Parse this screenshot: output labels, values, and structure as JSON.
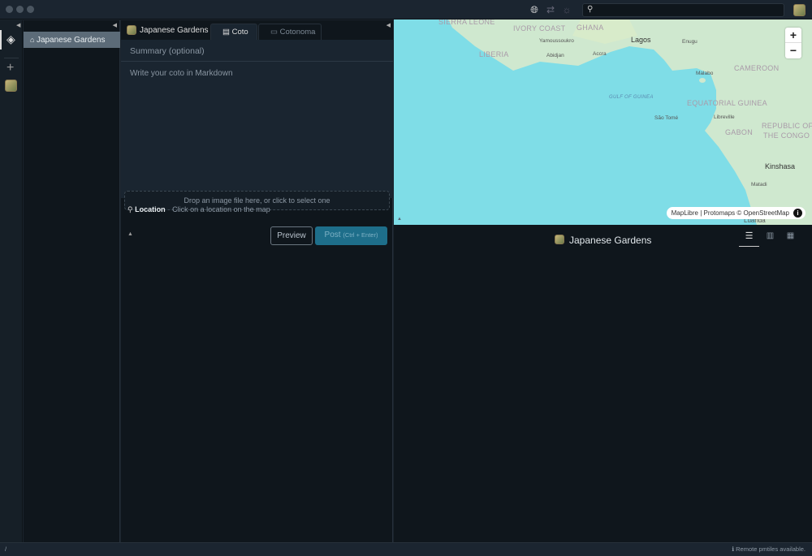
{
  "sidebar": {
    "collapse_icon": "caret-left-icon",
    "rail": [
      {
        "icon": "layers-icon"
      },
      {
        "icon": "plus-icon"
      },
      {
        "icon": "cotonoma-avatar"
      }
    ],
    "items": [
      {
        "label": "Japanese Gardens",
        "icon": "home-icon"
      }
    ]
  },
  "toolbar": {
    "icons": [
      "globe-icon",
      "swap-icon",
      "sun-icon"
    ],
    "search_placeholder": ""
  },
  "editor": {
    "cotonoma": "Japanese Gardens",
    "tabs": [
      {
        "label": "Coto",
        "icon": "document-icon",
        "active": true
      },
      {
        "label": "Cotonoma",
        "icon": "folder-icon",
        "active": false
      }
    ],
    "summary_placeholder": "Summary (optional)",
    "body_placeholder": "Write your coto in Markdown",
    "drop_text": "Drop an image file here, or click to select one",
    "location_label": "Location",
    "location_hint": "Click on a location on the map",
    "preview_label": "Preview",
    "post_label": "Post",
    "post_shortcut": "(Ctrl + Enter)"
  },
  "map": {
    "labels": {
      "countries": [
        "SIERRA LEONE",
        "IVORY COAST",
        "GHANA",
        "LIBERIA",
        "CAMEROON",
        "EQUATORIAL GUINEA",
        "GABON",
        "REPUBLIC OF",
        "THE CONGO"
      ],
      "sea": "GULF OF GUINEA",
      "cities": [
        "Yamoussoukro",
        "Abidjan",
        "Accra",
        "Lagos",
        "Enugu",
        "Malabo",
        "São Tomé",
        "Libreville",
        "Kinshasa",
        "Matadi",
        "Luanda"
      ]
    },
    "zoom_in": "+",
    "zoom_out": "−",
    "attribution": "MapLibre | Protomaps © OpenStreetMap",
    "colors": {
      "water": "#7fdde7",
      "land": "#cfe8cf"
    }
  },
  "timeline": {
    "title": "Japanese Gardens",
    "views": [
      {
        "icon": "rows-icon",
        "active": true
      },
      {
        "icon": "columns-icon",
        "active": false
      },
      {
        "icon": "grid-icon",
        "active": false
      }
    ]
  },
  "status": {
    "left": "/",
    "right": "Remote pmtiles available."
  }
}
